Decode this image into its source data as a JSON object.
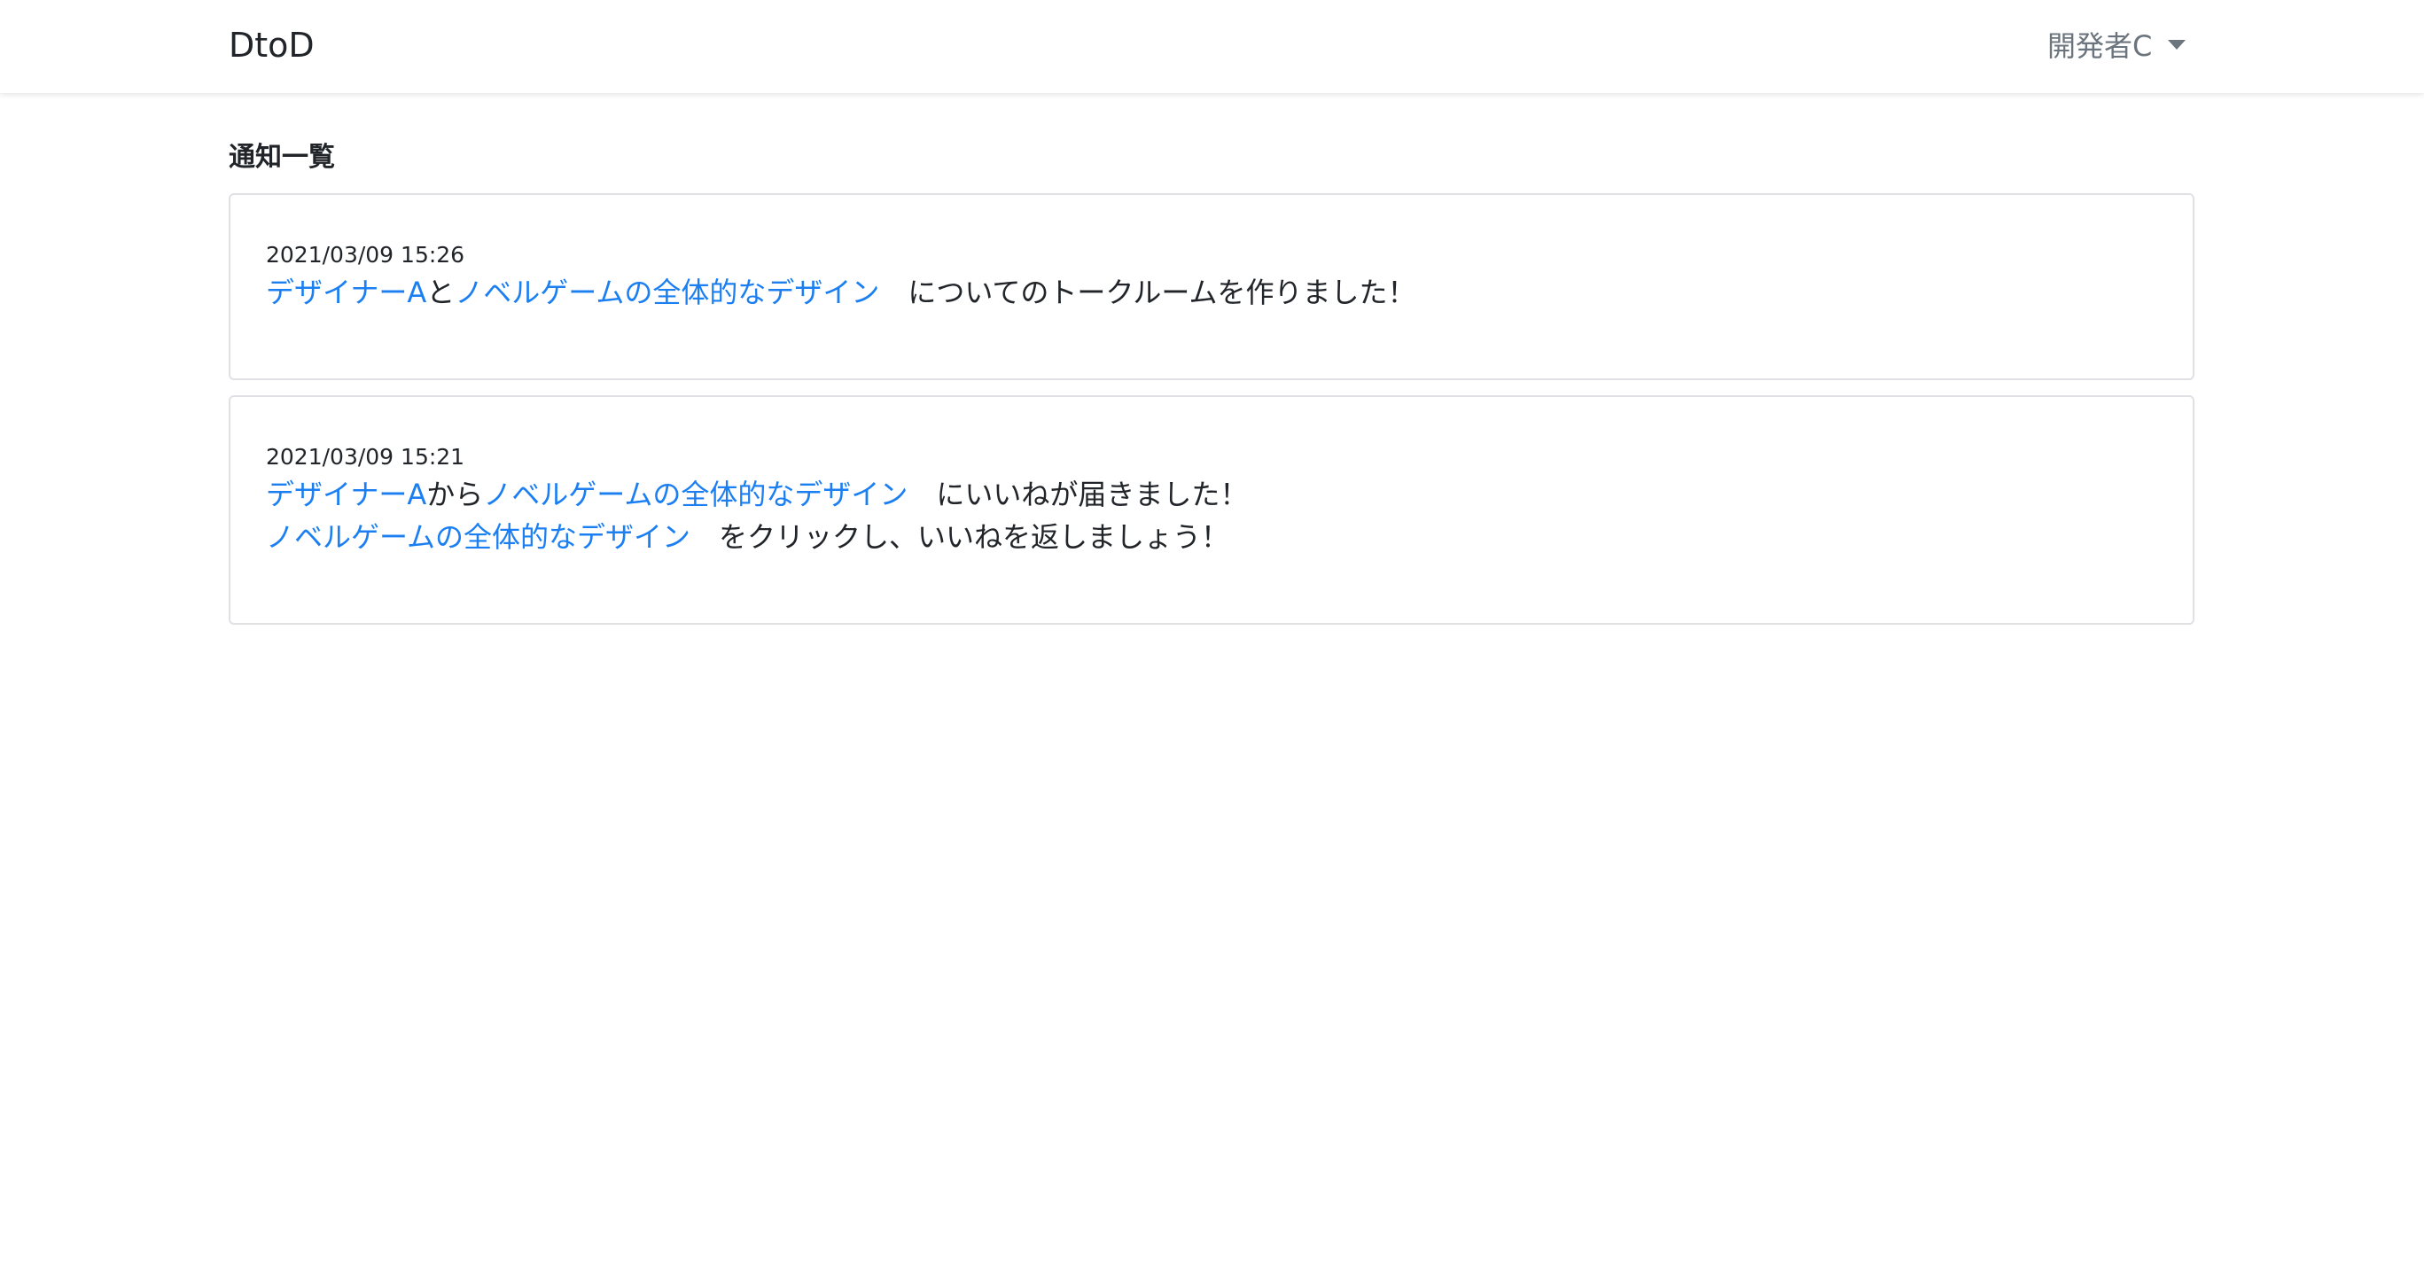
{
  "navbar": {
    "brand": "DtoD",
    "user_name": "開発者C"
  },
  "page": {
    "title": "通知一覧"
  },
  "notifications": [
    {
      "timestamp": "2021/03/09 15:26",
      "lines": [
        {
          "user_link": "デザイナーA",
          "connector": "と",
          "project_link": "ノベルゲームの全体的なデザイン",
          "message": "についてのトークルームを作りました！"
        }
      ]
    },
    {
      "timestamp": "2021/03/09 15:21",
      "lines": [
        {
          "user_link": "デザイナーA",
          "connector": "から",
          "project_link": "ノベルゲームの全体的なデザイン",
          "message": "にいいねが届きました！"
        },
        {
          "project_link": "ノベルゲームの全体的なデザイン",
          "message": "をクリックし、いいねを返しましょう！"
        }
      ]
    }
  ],
  "colors": {
    "link": "#1b7ff2",
    "text": "#212529",
    "muted": "#6c757d",
    "border": "#dfe1e4"
  }
}
